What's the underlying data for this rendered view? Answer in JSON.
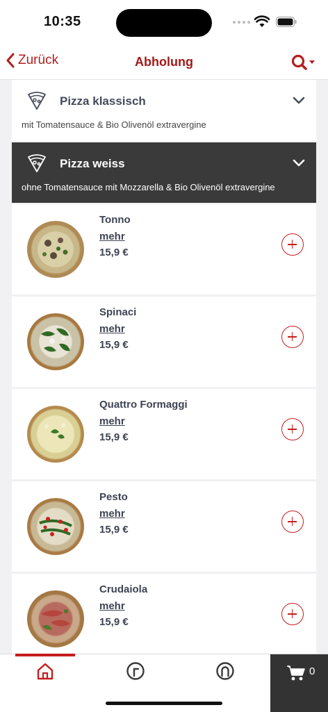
{
  "status": {
    "time": "10:35"
  },
  "nav": {
    "back_label": "Zurück",
    "title": "Abholung"
  },
  "categories": [
    {
      "title": "Pizza klassisch",
      "description": "mit Tomatensauce & Bio Olivenöl extravergine",
      "expanded": false
    },
    {
      "title": "Pizza weiss",
      "description": "ohne Tomatensauce mit Mozzarella & Bio Olivenöl extravergine",
      "expanded": true
    }
  ],
  "items": [
    {
      "name": "Tonno",
      "more": "mehr",
      "price": "15,9 €"
    },
    {
      "name": "Spinaci",
      "more": "mehr",
      "price": "15,9 €"
    },
    {
      "name": "Quattro Formaggi",
      "more": "mehr",
      "price": "15,9 €"
    },
    {
      "name": "Pesto",
      "more": "mehr",
      "price": "15,9 €"
    },
    {
      "name": "Crudaiola",
      "more": "mehr",
      "price": "15,9 €"
    }
  ],
  "tabbar": {
    "cart_count": "0",
    "tabs": [
      "home-icon",
      "history-icon",
      "account-icon"
    ]
  },
  "colors": {
    "accent": "#c61d1d",
    "dark_header": "#3a3a3a",
    "background": "#f1f1f3"
  }
}
